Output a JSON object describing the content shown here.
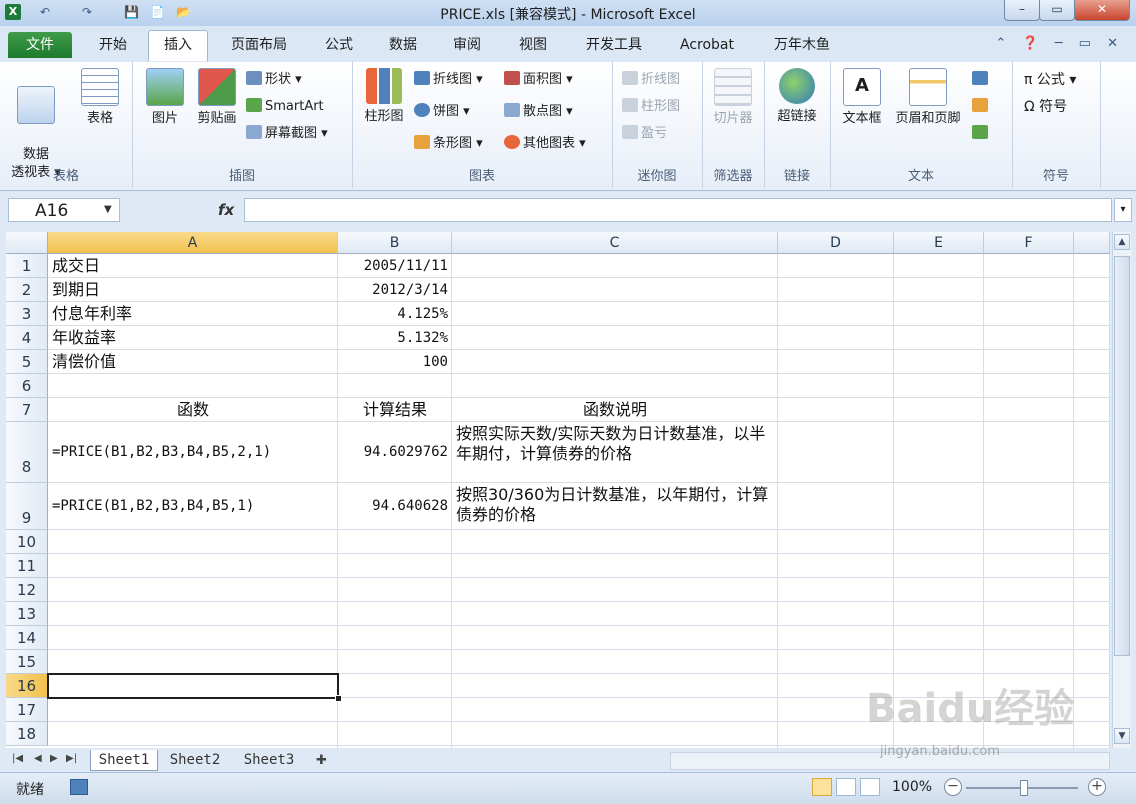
{
  "window": {
    "title": "PRICE.xls  [兼容模式] - Microsoft Excel",
    "app_icon": "X",
    "controls": [
      "–",
      "▭",
      "✕"
    ]
  },
  "quick_access": [
    "↶",
    "↷",
    "💾",
    "📄",
    "📂"
  ],
  "tabs": [
    "文件",
    "开始",
    "插入",
    "页面布局",
    "公式",
    "数据",
    "审阅",
    "视图",
    "开发工具",
    "Acrobat",
    "万年木鱼"
  ],
  "active_tab": "插入",
  "ribbon": {
    "groups": {
      "tables": {
        "label": "表格",
        "pivot": "数据\n透视表 ▾",
        "table": "表格"
      },
      "illustrations": {
        "label": "插图",
        "picture": "图片",
        "clipart": "剪贴画",
        "shapes": "形状 ▾",
        "smartart": "SmartArt",
        "screenshot": "屏幕截图 ▾"
      },
      "charts": {
        "label": "图表",
        "column": "柱形图",
        "line": "折线图 ▾",
        "pie": "饼图 ▾",
        "bar": "条形图 ▾",
        "area": "面积图 ▾",
        "scatter": "散点图 ▾",
        "other": "其他图表 ▾"
      },
      "sparklines": {
        "label": "迷你图",
        "line": "折线图",
        "column": "柱形图",
        "winloss": "盈亏"
      },
      "filter": {
        "label": "筛选器",
        "slicer": "切片器"
      },
      "links": {
        "label": "链接",
        "hyperlink": "超链接"
      },
      "text": {
        "label": "文本",
        "textbox": "文本框",
        "headerfooter": "页眉和页脚"
      },
      "symbols": {
        "label": "符号",
        "equation": "π 公式 ▾",
        "symbol": "Ω 符号"
      }
    }
  },
  "formula_bar": {
    "name_box": "A16",
    "fx": "fx",
    "formula": ""
  },
  "columns": [
    "A",
    "B",
    "C",
    "D",
    "E",
    "F"
  ],
  "rows": [
    "1",
    "2",
    "3",
    "4",
    "5",
    "6",
    "7",
    "8",
    "9",
    "10",
    "11",
    "12",
    "13",
    "14",
    "15",
    "16",
    "17",
    "18"
  ],
  "cells": {
    "A1": "成交日",
    "B1": "2005/11/11",
    "A2": "到期日",
    "B2": "2012/3/14",
    "A3": "付息年利率",
    "B3": "4.125%",
    "A4": "年收益率",
    "B4": "5.132%",
    "A5": "清偿价值",
    "B5": "100",
    "A7": "函数",
    "B7": "计算结果",
    "C7": "函数说明",
    "A8": "=PRICE(B1,B2,B3,B4,B5,2,1)",
    "B8": "94.6029762",
    "C8": "按照实际天数/实际天数为日计数基准，以半年期付，计算债券的价格",
    "A9": "=PRICE(B1,B2,B3,B4,B5,1)",
    "B9": "94.640628",
    "C9": "按照30/360为日计数基准，以年期付，计算债券的价格"
  },
  "selected_cell": "A16",
  "sheets": [
    "Sheet1",
    "Sheet2",
    "Sheet3"
  ],
  "active_sheet": "Sheet1",
  "status": {
    "text": "就绪",
    "zoom": "100%"
  },
  "watermark": {
    "logo": "Baidu经验",
    "url": "jingyan.baidu.com"
  }
}
